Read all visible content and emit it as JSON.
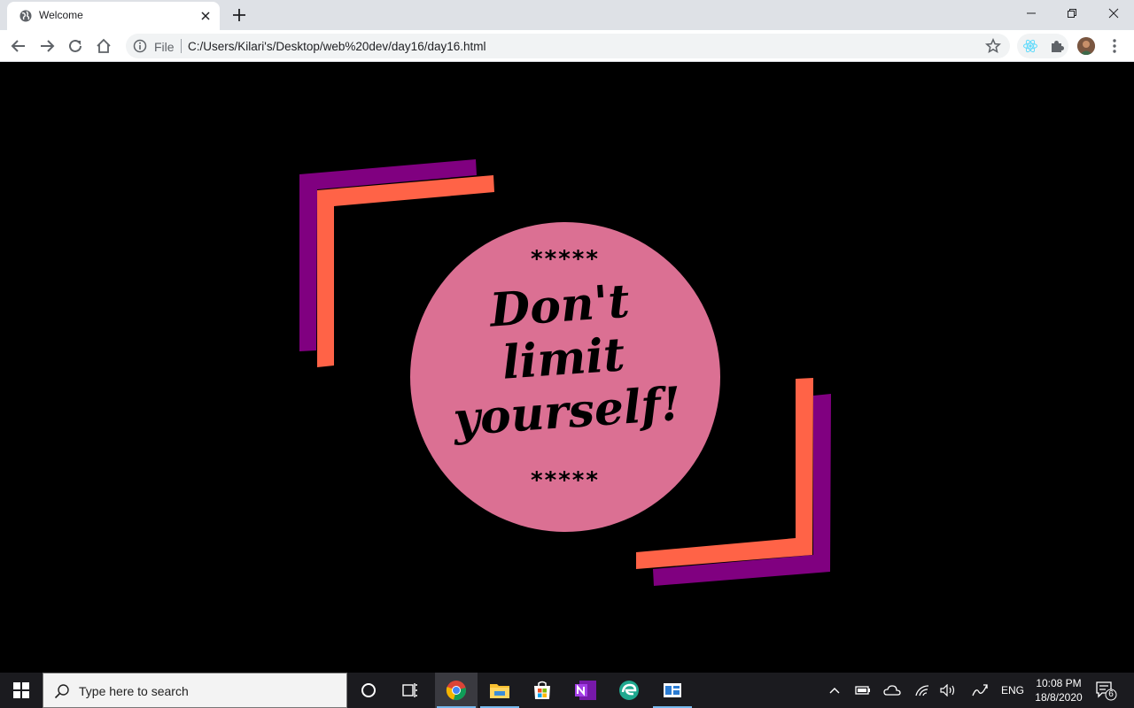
{
  "browser": {
    "tab_title": "Welcome",
    "address_prefix": "File",
    "url": "C:/Users/Kilari's/Desktop/web%20dev/day16/day16.html"
  },
  "page": {
    "quote_lines": [
      "Don't",
      "limit",
      "yourself!"
    ],
    "stars_top": "*****",
    "stars_bottom": "*****"
  },
  "taskbar": {
    "search_placeholder": "Type here to search",
    "language": "ENG",
    "time": "10:08 PM",
    "date": "18/8/2020",
    "notification_count": "6",
    "apps": [
      "task-view",
      "chrome",
      "file-explorer",
      "microsoft-store",
      "onenote",
      "edge",
      "app-window"
    ]
  },
  "colors": {
    "circle": "#db7093",
    "purple_bracket": "#800080",
    "orange_bracket": "#ff6347",
    "background": "#000000"
  }
}
